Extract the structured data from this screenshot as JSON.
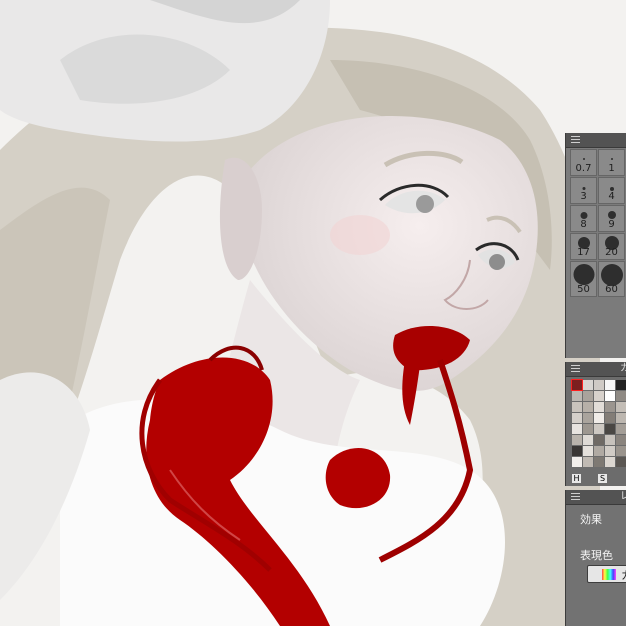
{
  "artwork": {
    "description_icon": "painting-canvas"
  },
  "brush_size_panel": {
    "sizes": [
      "0.7",
      "1",
      "3",
      "4",
      "8",
      "9",
      "17",
      "20",
      "50",
      "60"
    ]
  },
  "color_panel": {
    "title": "カ",
    "h_label": "H",
    "s_label": "S",
    "swatches": [
      "#7c1f1f",
      "#d9d6d2",
      "#cfcac5",
      "#f6f6f6",
      "#222222",
      "#bcb8b2",
      "#a9a39c",
      "#d8d2cc",
      "#ffffff",
      "#8f8a84",
      "#c9c3bc",
      "#b7b0a8",
      "#e2ddd8",
      "#9b958f",
      "#c3bdb6",
      "#d5d0ca",
      "#aaa49d",
      "#f0ece8",
      "#837d77",
      "#bdb7b0",
      "#e8e4e0",
      "#9d9790",
      "#cdc8c2",
      "#4a4744",
      "#a49e97",
      "#b9b3ac",
      "#dedad5",
      "#6f6a65",
      "#c7c2bc",
      "#8a847e",
      "#3a3735",
      "#e5e1dc",
      "#b0aaa3",
      "#d1ccc6",
      "#9a948d",
      "#f2efec",
      "#c0bab3",
      "#7e7973",
      "#dcd7d1",
      "#5b5753"
    ]
  },
  "layer_panel": {
    "title": "レ",
    "effect_label": "効果",
    "expression_color_label": "表現色",
    "color_mode_value": "カ"
  },
  "colors": {
    "panel_bg": "#6e6e6e",
    "title_bg": "#535353",
    "blood": "#b00000"
  }
}
